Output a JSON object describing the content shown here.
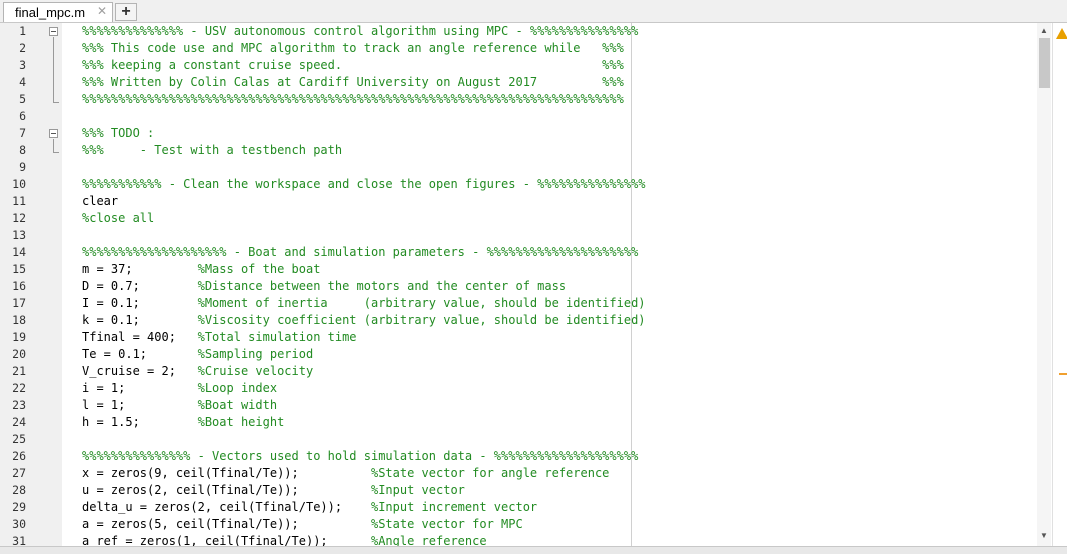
{
  "tabs": [
    {
      "label": "final_mpc.m"
    }
  ],
  "tab_add_label": "+",
  "tab_close_glyph": "✕",
  "colors": {
    "comment": "#228b22",
    "code": "#000000",
    "warning": "#e8a000"
  },
  "icons": {
    "warning": "warning-icon",
    "fold": "fold-toggle-icon"
  },
  "lines": [
    {
      "n": "1",
      "segs": [
        {
          "t": "%%%%%%%%%%%%%% - USV autonomous control algorithm using MPC - %%%%%%%%%%%%%%%",
          "c": "g"
        }
      ]
    },
    {
      "n": "2",
      "segs": [
        {
          "t": "%%% This code use and MPC algorithm to track an angle reference while   %%%",
          "c": "g"
        }
      ]
    },
    {
      "n": "3",
      "segs": [
        {
          "t": "%%% keeping a constant cruise speed.                                    %%%",
          "c": "g"
        }
      ]
    },
    {
      "n": "4",
      "segs": [
        {
          "t": "%%% Written by Colin Calas at Cardiff University on August 2017         %%%",
          "c": "g"
        }
      ]
    },
    {
      "n": "5",
      "segs": [
        {
          "t": "%%%%%%%%%%%%%%%%%%%%%%%%%%%%%%%%%%%%%%%%%%%%%%%%%%%%%%%%%%%%%%%%%%%%%%%%%%%",
          "c": "g"
        }
      ]
    },
    {
      "n": "6",
      "segs": []
    },
    {
      "n": "7",
      "segs": [
        {
          "t": "%%% TODO :",
          "c": "g"
        }
      ]
    },
    {
      "n": "8",
      "segs": [
        {
          "t": "%%%     - Test with a testbench path",
          "c": "g"
        }
      ]
    },
    {
      "n": "9",
      "segs": []
    },
    {
      "n": "10",
      "segs": [
        {
          "t": "%%%%%%%%%%% - Clean the workspace and close the open figures - %%%%%%%%%%%%%%%",
          "c": "g"
        }
      ]
    },
    {
      "n": "11",
      "segs": [
        {
          "t": "clear",
          "c": "k"
        }
      ]
    },
    {
      "n": "12",
      "segs": [
        {
          "t": "%close all",
          "c": "g"
        }
      ]
    },
    {
      "n": "13",
      "segs": []
    },
    {
      "n": "14",
      "segs": [
        {
          "t": "%%%%%%%%%%%%%%%%%%%% - Boat and simulation parameters - %%%%%%%%%%%%%%%%%%%%%",
          "c": "g"
        }
      ]
    },
    {
      "n": "15",
      "segs": [
        {
          "t": "m = 37;         ",
          "c": "k"
        },
        {
          "t": "%Mass of the boat",
          "c": "g"
        }
      ]
    },
    {
      "n": "16",
      "segs": [
        {
          "t": "D = 0.7;        ",
          "c": "k"
        },
        {
          "t": "%Distance between the motors and the center of mass",
          "c": "g"
        }
      ]
    },
    {
      "n": "17",
      "segs": [
        {
          "t": "I = 0.1;        ",
          "c": "k"
        },
        {
          "t": "%Moment of inertia     (arbitrary value, should be identified)",
          "c": "g"
        }
      ]
    },
    {
      "n": "18",
      "segs": [
        {
          "t": "k = 0.1;        ",
          "c": "k"
        },
        {
          "t": "%Viscosity coefficient (arbitrary value, should be identified)",
          "c": "g"
        }
      ]
    },
    {
      "n": "19",
      "segs": [
        {
          "t": "Tfinal = 400;   ",
          "c": "k"
        },
        {
          "t": "%Total simulation time",
          "c": "g"
        }
      ]
    },
    {
      "n": "20",
      "segs": [
        {
          "t": "Te = 0.1;       ",
          "c": "k"
        },
        {
          "t": "%Sampling period",
          "c": "g"
        }
      ]
    },
    {
      "n": "21",
      "segs": [
        {
          "t": "V_cruise = 2;   ",
          "c": "k"
        },
        {
          "t": "%Cruise velocity",
          "c": "g"
        }
      ]
    },
    {
      "n": "22",
      "segs": [
        {
          "t": "i = 1;          ",
          "c": "k"
        },
        {
          "t": "%Loop index",
          "c": "g"
        }
      ]
    },
    {
      "n": "23",
      "segs": [
        {
          "t": "l = 1;          ",
          "c": "k"
        },
        {
          "t": "%Boat width",
          "c": "g"
        }
      ]
    },
    {
      "n": "24",
      "segs": [
        {
          "t": "h = 1.5;        ",
          "c": "k"
        },
        {
          "t": "%Boat height",
          "c": "g"
        }
      ]
    },
    {
      "n": "25",
      "segs": []
    },
    {
      "n": "26",
      "segs": [
        {
          "t": "%%%%%%%%%%%%%%% - Vectors used to hold simulation data - %%%%%%%%%%%%%%%%%%%%",
          "c": "g"
        }
      ]
    },
    {
      "n": "27",
      "segs": [
        {
          "t": "x = zeros(9, ceil(Tfinal/Te));          ",
          "c": "k"
        },
        {
          "t": "%State vector for angle reference",
          "c": "g"
        }
      ]
    },
    {
      "n": "28",
      "segs": [
        {
          "t": "u = zeros(2, ceil(Tfinal/Te));          ",
          "c": "k"
        },
        {
          "t": "%Input vector",
          "c": "g"
        }
      ]
    },
    {
      "n": "29",
      "segs": [
        {
          "t": "delta_u = zeros(2, ceil(Tfinal/Te));    ",
          "c": "k"
        },
        {
          "t": "%Input increment vector",
          "c": "g"
        }
      ]
    },
    {
      "n": "30",
      "segs": [
        {
          "t": "a = zeros(5, ceil(Tfinal/Te));          ",
          "c": "k"
        },
        {
          "t": "%State vector for MPC",
          "c": "g"
        }
      ]
    },
    {
      "n": "31",
      "segs": [
        {
          "t": "a_ref = zeros(1, ceil(Tfinal/Te));      ",
          "c": "k"
        },
        {
          "t": "%Angle reference",
          "c": "g"
        }
      ]
    }
  ]
}
